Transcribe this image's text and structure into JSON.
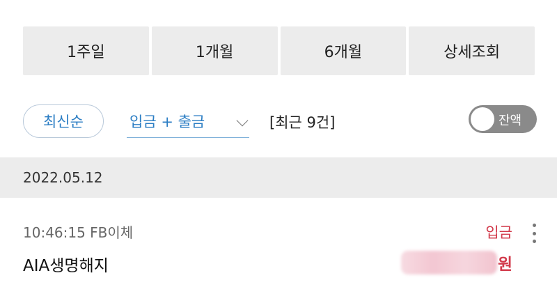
{
  "period_tabs": [
    {
      "label": "1주일"
    },
    {
      "label": "1개월"
    },
    {
      "label": "6개월"
    },
    {
      "label": "상세조회"
    }
  ],
  "filters": {
    "sort_label": "최신순",
    "type_label": "입금 + 출금",
    "count_text": "[최근 9건]"
  },
  "balance_toggle": {
    "label": "잔액",
    "on": false
  },
  "transactions": [
    {
      "date": "2022.05.12",
      "meta": "10:46:15 FB이체",
      "description": "AIA생명해지",
      "type": "입금",
      "currency_suffix": "원"
    }
  ],
  "colors": {
    "accent_blue": "#2c7ec4",
    "deposit_red": "#d23a4b",
    "button_gray": "#ececec",
    "toggle_off": "#8a8a8a"
  }
}
